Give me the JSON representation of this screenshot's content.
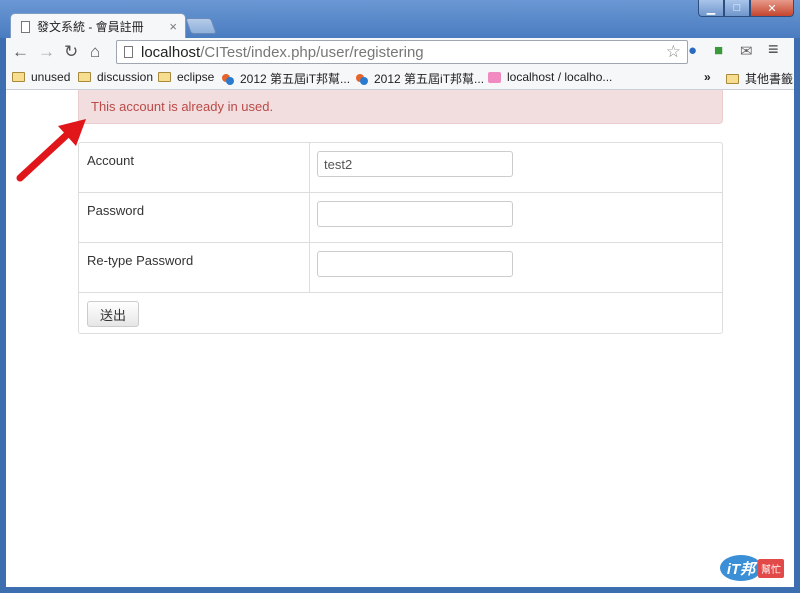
{
  "tab": {
    "title": "發文系統 - 會員註冊",
    "close_symbol": "×"
  },
  "window_controls": {
    "minimize": "▁",
    "maximize": "□",
    "close": "✕"
  },
  "toolbar": {
    "back": "←",
    "forward": "→",
    "reload": "↻",
    "home": "⌂",
    "url_host": "localhost",
    "url_path": "/CITest/index.php/user/registering",
    "star": "☆",
    "menu": "≡"
  },
  "bookmarks": {
    "items": [
      {
        "label": "unused",
        "icon": "folder-icon"
      },
      {
        "label": "discussion",
        "icon": "folder-icon"
      },
      {
        "label": "eclipse",
        "icon": "folder-icon"
      },
      {
        "label": "2012 第五屆iT邦幫...",
        "icon": "ithome-icon"
      },
      {
        "label": "2012 第五屆iT邦幫...",
        "icon": "ithome-icon"
      },
      {
        "label": "localhost / localho...",
        "icon": "phpmyadmin-icon"
      }
    ],
    "overflow": "»",
    "other": "其他書籤"
  },
  "alert": {
    "message": "This account is already in used."
  },
  "form": {
    "fields": [
      {
        "label": "Account",
        "value": "test2",
        "type": "text"
      },
      {
        "label": "Password",
        "value": "",
        "type": "password"
      },
      {
        "label": "Re-type Password",
        "value": "",
        "type": "password"
      }
    ],
    "submit_label": "送出"
  },
  "watermark": {
    "logo_text": "iT邦",
    "tag": "幫忙"
  },
  "colors": {
    "alert_bg": "#f2dede",
    "alert_text": "#b94a48",
    "arrow": "#e0161b",
    "frame": "#3d6fb0"
  }
}
